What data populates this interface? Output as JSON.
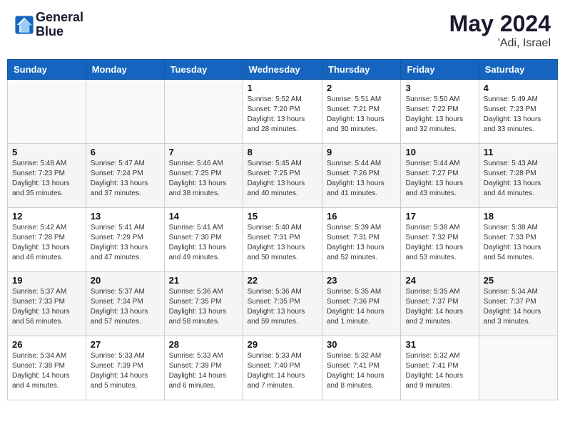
{
  "header": {
    "logo_line1": "General",
    "logo_line2": "Blue",
    "month": "May 2024",
    "location": "'Adi, Israel"
  },
  "weekdays": [
    "Sunday",
    "Monday",
    "Tuesday",
    "Wednesday",
    "Thursday",
    "Friday",
    "Saturday"
  ],
  "weeks": [
    [
      {
        "day": "",
        "info": ""
      },
      {
        "day": "",
        "info": ""
      },
      {
        "day": "",
        "info": ""
      },
      {
        "day": "1",
        "info": "Sunrise: 5:52 AM\nSunset: 7:20 PM\nDaylight: 13 hours\nand 28 minutes."
      },
      {
        "day": "2",
        "info": "Sunrise: 5:51 AM\nSunset: 7:21 PM\nDaylight: 13 hours\nand 30 minutes."
      },
      {
        "day": "3",
        "info": "Sunrise: 5:50 AM\nSunset: 7:22 PM\nDaylight: 13 hours\nand 32 minutes."
      },
      {
        "day": "4",
        "info": "Sunrise: 5:49 AM\nSunset: 7:23 PM\nDaylight: 13 hours\nand 33 minutes."
      }
    ],
    [
      {
        "day": "5",
        "info": "Sunrise: 5:48 AM\nSunset: 7:23 PM\nDaylight: 13 hours\nand 35 minutes."
      },
      {
        "day": "6",
        "info": "Sunrise: 5:47 AM\nSunset: 7:24 PM\nDaylight: 13 hours\nand 37 minutes."
      },
      {
        "day": "7",
        "info": "Sunrise: 5:46 AM\nSunset: 7:25 PM\nDaylight: 13 hours\nand 38 minutes."
      },
      {
        "day": "8",
        "info": "Sunrise: 5:45 AM\nSunset: 7:25 PM\nDaylight: 13 hours\nand 40 minutes."
      },
      {
        "day": "9",
        "info": "Sunrise: 5:44 AM\nSunset: 7:26 PM\nDaylight: 13 hours\nand 41 minutes."
      },
      {
        "day": "10",
        "info": "Sunrise: 5:44 AM\nSunset: 7:27 PM\nDaylight: 13 hours\nand 43 minutes."
      },
      {
        "day": "11",
        "info": "Sunrise: 5:43 AM\nSunset: 7:28 PM\nDaylight: 13 hours\nand 44 minutes."
      }
    ],
    [
      {
        "day": "12",
        "info": "Sunrise: 5:42 AM\nSunset: 7:28 PM\nDaylight: 13 hours\nand 46 minutes."
      },
      {
        "day": "13",
        "info": "Sunrise: 5:41 AM\nSunset: 7:29 PM\nDaylight: 13 hours\nand 47 minutes."
      },
      {
        "day": "14",
        "info": "Sunrise: 5:41 AM\nSunset: 7:30 PM\nDaylight: 13 hours\nand 49 minutes."
      },
      {
        "day": "15",
        "info": "Sunrise: 5:40 AM\nSunset: 7:31 PM\nDaylight: 13 hours\nand 50 minutes."
      },
      {
        "day": "16",
        "info": "Sunrise: 5:39 AM\nSunset: 7:31 PM\nDaylight: 13 hours\nand 52 minutes."
      },
      {
        "day": "17",
        "info": "Sunrise: 5:38 AM\nSunset: 7:32 PM\nDaylight: 13 hours\nand 53 minutes."
      },
      {
        "day": "18",
        "info": "Sunrise: 5:38 AM\nSunset: 7:33 PM\nDaylight: 13 hours\nand 54 minutes."
      }
    ],
    [
      {
        "day": "19",
        "info": "Sunrise: 5:37 AM\nSunset: 7:33 PM\nDaylight: 13 hours\nand 56 minutes."
      },
      {
        "day": "20",
        "info": "Sunrise: 5:37 AM\nSunset: 7:34 PM\nDaylight: 13 hours\nand 57 minutes."
      },
      {
        "day": "21",
        "info": "Sunrise: 5:36 AM\nSunset: 7:35 PM\nDaylight: 13 hours\nand 58 minutes."
      },
      {
        "day": "22",
        "info": "Sunrise: 5:36 AM\nSunset: 7:35 PM\nDaylight: 13 hours\nand 59 minutes."
      },
      {
        "day": "23",
        "info": "Sunrise: 5:35 AM\nSunset: 7:36 PM\nDaylight: 14 hours\nand 1 minute."
      },
      {
        "day": "24",
        "info": "Sunrise: 5:35 AM\nSunset: 7:37 PM\nDaylight: 14 hours\nand 2 minutes."
      },
      {
        "day": "25",
        "info": "Sunrise: 5:34 AM\nSunset: 7:37 PM\nDaylight: 14 hours\nand 3 minutes."
      }
    ],
    [
      {
        "day": "26",
        "info": "Sunrise: 5:34 AM\nSunset: 7:38 PM\nDaylight: 14 hours\nand 4 minutes."
      },
      {
        "day": "27",
        "info": "Sunrise: 5:33 AM\nSunset: 7:39 PM\nDaylight: 14 hours\nand 5 minutes."
      },
      {
        "day": "28",
        "info": "Sunrise: 5:33 AM\nSunset: 7:39 PM\nDaylight: 14 hours\nand 6 minutes."
      },
      {
        "day": "29",
        "info": "Sunrise: 5:33 AM\nSunset: 7:40 PM\nDaylight: 14 hours\nand 7 minutes."
      },
      {
        "day": "30",
        "info": "Sunrise: 5:32 AM\nSunset: 7:41 PM\nDaylight: 14 hours\nand 8 minutes."
      },
      {
        "day": "31",
        "info": "Sunrise: 5:32 AM\nSunset: 7:41 PM\nDaylight: 14 hours\nand 9 minutes."
      },
      {
        "day": "",
        "info": ""
      }
    ]
  ]
}
